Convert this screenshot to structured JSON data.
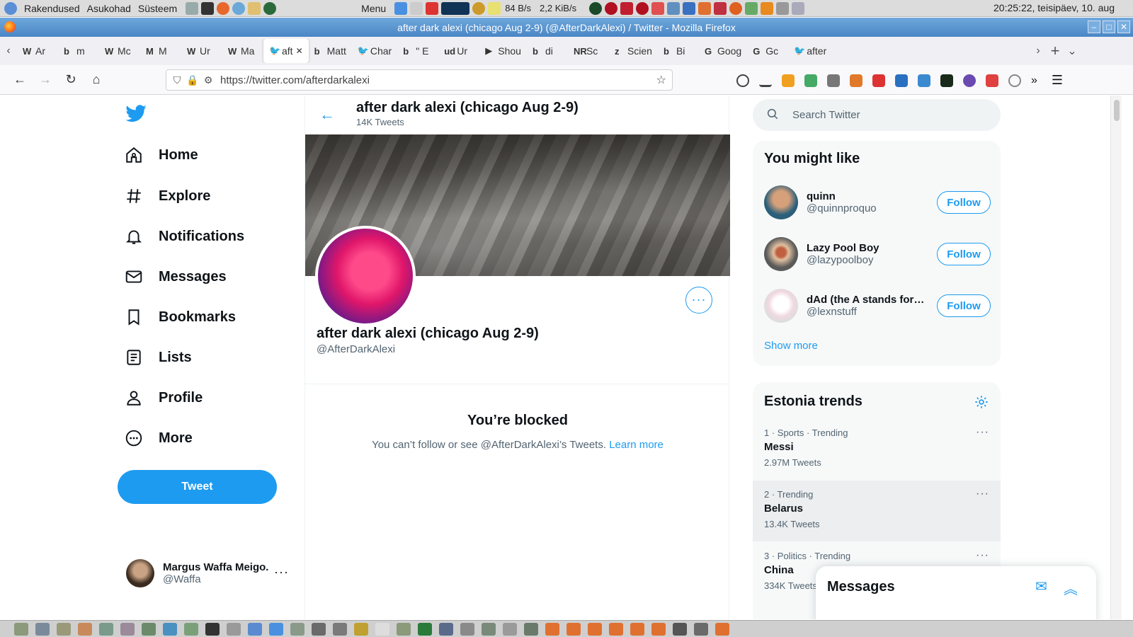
{
  "os": {
    "menus": [
      "Rakendused",
      "Asukohad",
      "Süsteem"
    ],
    "menu_label": "Menu",
    "net_down": "84 B/s",
    "net_up": "2,2 KiB/s",
    "clock": "20:25:22, teisipäev, 10. aug"
  },
  "window": {
    "title": "after dark alexi (chicago Aug 2-9) (@AfterDarkAlexi) / Twitter - Mozilla Firefox"
  },
  "tabs": [
    {
      "fav": "W",
      "label": "Ar"
    },
    {
      "fav": "b",
      "label": "m"
    },
    {
      "fav": "W",
      "label": "Mc"
    },
    {
      "fav": "M",
      "label": "M"
    },
    {
      "fav": "W",
      "label": "Ur"
    },
    {
      "fav": "W",
      "label": "Ma"
    },
    {
      "fav": "🐦",
      "label": "aft"
    },
    {
      "fav": "b",
      "label": "Matt"
    },
    {
      "fav": "🐦",
      "label": "Char"
    },
    {
      "fav": "b",
      "label": "\" E"
    },
    {
      "fav": "ud",
      "label": "Ur"
    },
    {
      "fav": "▶",
      "label": "Shou"
    },
    {
      "fav": "b",
      "label": "di"
    },
    {
      "fav": "NR",
      "label": "Sc"
    },
    {
      "fav": "z",
      "label": "Scien"
    },
    {
      "fav": "b",
      "label": "Bi"
    },
    {
      "fav": "G",
      "label": "Goog"
    },
    {
      "fav": "G",
      "label": "Gc"
    },
    {
      "fav": "🐦",
      "label": "after"
    }
  ],
  "url": "https://twitter.com/afterdarkalexi",
  "nav": [
    {
      "id": "home",
      "label": "Home"
    },
    {
      "id": "explore",
      "label": "Explore"
    },
    {
      "id": "notifications",
      "label": "Notifications"
    },
    {
      "id": "messages",
      "label": "Messages"
    },
    {
      "id": "bookmarks",
      "label": "Bookmarks"
    },
    {
      "id": "lists",
      "label": "Lists"
    },
    {
      "id": "profile",
      "label": "Profile"
    },
    {
      "id": "more",
      "label": "More"
    }
  ],
  "tweet_button": "Tweet",
  "account": {
    "name": "Margus Waffa Meigo.",
    "handle": "@Waffa"
  },
  "header": {
    "title": "after dark alexi (chicago Aug 2-9)",
    "subtitle": "14K Tweets"
  },
  "profile": {
    "name": "after dark alexi (chicago Aug 2-9)",
    "handle": "@AfterDarkAlexi",
    "blocked_title": "You’re blocked",
    "blocked_text": "You can’t follow or see @AfterDarkAlexi’s Tweets.",
    "learn_more": "Learn more"
  },
  "search": {
    "placeholder": "Search Twitter"
  },
  "who_to_follow": {
    "title": "You might like",
    "follow_label": "Follow",
    "show_more": "Show more",
    "users": [
      {
        "name": "quinn",
        "handle": "@quinnproquo"
      },
      {
        "name": "Lazy Pool Boy",
        "handle": "@lazypoolboy"
      },
      {
        "name": "dAd (the A stands for aca",
        "handle": "@lexnstuff"
      }
    ]
  },
  "trends": {
    "title": "Estonia trends",
    "items": [
      {
        "meta": "1 · Sports · Trending",
        "name": "Messi",
        "count": "2.97M Tweets"
      },
      {
        "meta": "2 · Trending",
        "name": "Belarus",
        "count": "13.4K Tweets"
      },
      {
        "meta": "3 · Politics · Trending",
        "name": "China",
        "count": "334K Tweets"
      }
    ]
  },
  "messages_drawer": {
    "title": "Messages"
  },
  "colors": {
    "twitter_blue": "#1d9bf0",
    "text_primary": "#0f1419",
    "text_secondary": "#536471"
  }
}
